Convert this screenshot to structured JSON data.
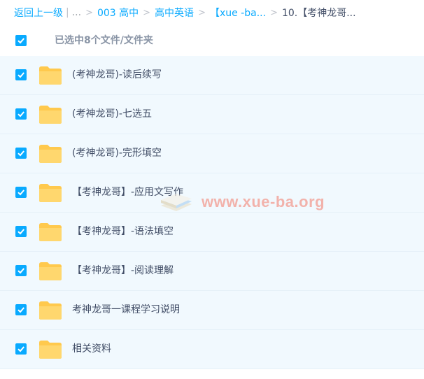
{
  "breadcrumb": {
    "back": "返回上一级",
    "ellipsis": "...",
    "items": [
      "003 高中",
      "高中英语",
      "【xue -ba..."
    ],
    "current": "10.【考神龙哥..."
  },
  "selection": {
    "label": "已选中8个文件/文件夹",
    "checked": true
  },
  "files": [
    {
      "name": "(考神龙哥)-读后续写",
      "type": "folder",
      "checked": true
    },
    {
      "name": "(考神龙哥)-七选五",
      "type": "folder",
      "checked": true
    },
    {
      "name": "(考神龙哥)-完形填空",
      "type": "folder",
      "checked": true
    },
    {
      "name": "【考神龙哥】-应用文写作",
      "type": "folder",
      "checked": true
    },
    {
      "name": "【考神龙哥】-语法填空",
      "type": "folder",
      "checked": true
    },
    {
      "name": "【考神龙哥】-阅读理解",
      "type": "folder",
      "checked": true
    },
    {
      "name": "考神龙哥一课程学习说明",
      "type": "folder",
      "checked": true
    },
    {
      "name": "相关资料",
      "type": "folder",
      "checked": true
    }
  ],
  "watermark": {
    "text": "www.xue-ba.org",
    "icon": "book-stack-icon"
  },
  "colors": {
    "accent": "#09aaff",
    "row_bg": "#f1f9fe",
    "folder": "#ffc94d",
    "text": "#424e67",
    "muted": "#8a95a6"
  }
}
